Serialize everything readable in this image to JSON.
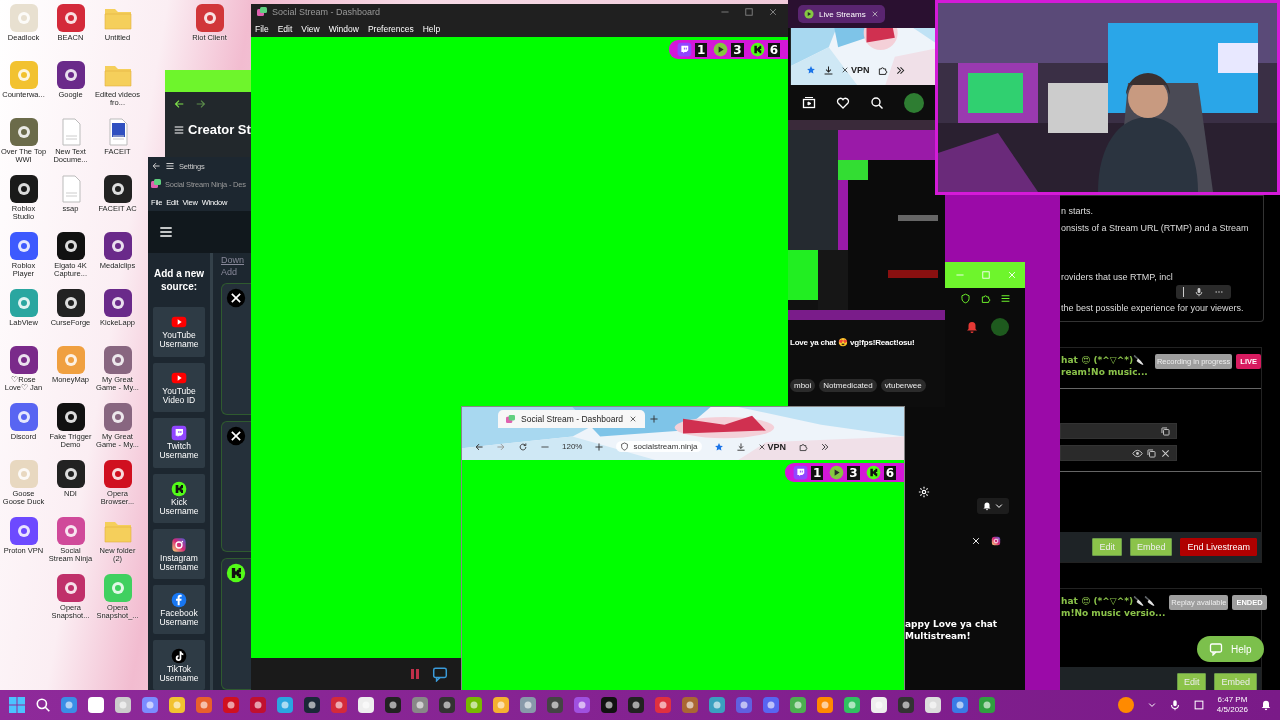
{
  "desktop": {
    "columns": [
      {
        "icons": [
          {
            "label": "Deadlock",
            "kind": "app",
            "color": "#e8e0d0"
          },
          {
            "label": "Counterwa...",
            "kind": "app",
            "color": "#f2c230"
          },
          {
            "label": "Over The Top WWI",
            "kind": "app",
            "color": "#6b6b4a"
          },
          {
            "label": "Roblox Studio",
            "kind": "app",
            "color": "#1a1a1a"
          },
          {
            "label": "Roblox Player",
            "kind": "app",
            "color": "#3d5afe"
          },
          {
            "label": "LabView",
            "kind": "app",
            "color": "#2aa6a0"
          },
          {
            "label": "♡Rose Love♡ Jan",
            "kind": "app",
            "color": "#7a2a8a"
          },
          {
            "label": "Discord",
            "kind": "app",
            "color": "#5865f2"
          },
          {
            "label": "Goose Goose Duck",
            "kind": "app",
            "color": "#e8d8c0"
          },
          {
            "label": "Proton VPN",
            "kind": "app",
            "color": "#6d4aff"
          }
        ]
      },
      {
        "icons": [
          {
            "label": "BEACN",
            "kind": "app",
            "color": "#d42a3a"
          },
          {
            "label": "Google",
            "kind": "app",
            "color": "#6a2a8a"
          },
          {
            "label": "New Text Docume...",
            "kind": "document",
            "color": "#ffffff"
          },
          {
            "label": "ssap",
            "kind": "document",
            "color": "#ffffff"
          },
          {
            "label": "Elgato 4K Capture...",
            "kind": "app",
            "color": "#111111"
          },
          {
            "label": "CurseForge",
            "kind": "app",
            "color": "#222222"
          },
          {
            "label": "MoneyMap",
            "kind": "app",
            "color": "#f0a040"
          },
          {
            "label": "Fake Trigger Demo",
            "kind": "app",
            "color": "#111111"
          },
          {
            "label": "NDI",
            "kind": "app",
            "color": "#222222"
          },
          {
            "label": "Social Stream Ninja",
            "kind": "app",
            "color": "#d04a9a"
          },
          {
            "label": "Opera Snapshot...",
            "kind": "app",
            "color": "#c0306a"
          }
        ]
      },
      {
        "icons": [
          {
            "label": "Untitled",
            "kind": "folder",
            "color": "#f5cf5b"
          },
          {
            "label": "Edited videos fro...",
            "kind": "folder",
            "color": "#f5cf5b"
          },
          {
            "label": "FACEIT",
            "kind": "document",
            "color": "#3050c0"
          },
          {
            "label": "FACEIT AC",
            "kind": "app",
            "color": "#222222"
          },
          {
            "label": "Medalclips",
            "kind": "app",
            "color": "#6a2a8a"
          },
          {
            "label": "KickeLapp",
            "kind": "app",
            "color": "#6a2a8a"
          },
          {
            "label": "My Great Game - My...",
            "kind": "app",
            "color": "#886680"
          },
          {
            "label": "My Great Game - My...",
            "kind": "app",
            "color": "#886680"
          },
          {
            "label": "Opera Browser...",
            "kind": "app",
            "color": "#d01020"
          },
          {
            "label": "New folder (2)",
            "kind": "folder",
            "color": "#f5cf5b"
          },
          {
            "label": "Opera Snapshot_...",
            "kind": "app",
            "color": "#40d060"
          }
        ]
      }
    ],
    "corner_icon": {
      "label": "Riot Client",
      "kind": "app",
      "color": "#d13639"
    }
  },
  "creator_window": {
    "title": "Creator St"
  },
  "ssn_window": {
    "nav_label": "Settings",
    "title": "Social Stream Ninja - Des",
    "menu": [
      "File",
      "Edit",
      "View",
      "Window"
    ],
    "link": "Down",
    "hint": "Add",
    "heading": "Add a new source:",
    "sources": [
      {
        "label": "YouTube Username",
        "kind": "youtube"
      },
      {
        "label": "YouTube Video ID",
        "kind": "youtube"
      },
      {
        "label": "Twitch Username",
        "kind": "twitch"
      },
      {
        "label": "Kick Username",
        "kind": "kick"
      },
      {
        "label": "Instagram Username",
        "kind": "instagram"
      },
      {
        "label": "Facebook Username",
        "kind": "facebook"
      },
      {
        "label": "TikTok Username",
        "kind": "tiktok"
      }
    ],
    "cards": [
      {
        "kind": "x"
      },
      {
        "kind": "x"
      },
      {
        "kind": "kick"
      }
    ]
  },
  "dashboard_window": {
    "title": "Social Stream - Dashboard",
    "menu": [
      "File",
      "Edit",
      "View",
      "Window",
      "Preferences",
      "Help"
    ],
    "counts": [
      {
        "kind": "twitch",
        "value": "1"
      },
      {
        "kind": "rumble",
        "value": "3"
      },
      {
        "kind": "kick",
        "value": "6"
      }
    ]
  },
  "stream_page": {
    "tabs": [
      {
        "label": "Live Streams",
        "selected": true
      }
    ],
    "vpn": "VPN",
    "stream_title": "Love ya chat 😍 vg!fps!React!osu!",
    "tags": [
      "mboi",
      "Notmedicated",
      "vtuberwee"
    ]
  },
  "side_window": {
    "lines": [
      "appy Love ya chat",
      "Multistream!"
    ]
  },
  "studio_panel": {
    "intro": [
      "n starts.",
      "onsists of a Stream URL (RTMP) and a Stream",
      "roviders that use RTMP, incl",
      "the best possible experience for your viewers."
    ],
    "streams": [
      {
        "title": "hat 😍 (*^▽^*)🔪",
        "subtitle": "ream!No music...",
        "status": "Recording in progress",
        "badge": "LIVE",
        "live": true,
        "buttons": [
          {
            "label": "Edit",
            "kind": "light"
          },
          {
            "label": "Embed",
            "kind": "light"
          },
          {
            "label": "End Livestream",
            "kind": "danger"
          }
        ]
      },
      {
        "title": "hat 😍 (*^▽^*)🔪🔪",
        "subtitle": "m!No music versio...",
        "status": "Replay available",
        "badge": "ENDED",
        "live": false,
        "buttons": [
          {
            "label": "Edit",
            "kind": "light"
          },
          {
            "label": "Embed",
            "kind": "light"
          }
        ]
      }
    ],
    "help": "Help"
  },
  "mini_browser": {
    "tab": "Social Stream - Dashboard",
    "zoom": "120%",
    "url": "socialstream.ninja",
    "vpn": "VPN",
    "counts": [
      {
        "kind": "twitch",
        "value": "1"
      },
      {
        "kind": "rumble",
        "value": "3"
      },
      {
        "kind": "kick",
        "value": "6"
      }
    ]
  },
  "taskbar": {
    "apps": [
      {
        "color": "#3a8ee6"
      },
      {
        "color": "#ffffff"
      },
      {
        "color": "#cccccc"
      },
      {
        "color": "#7b8cff"
      },
      {
        "color": "#f2c230"
      },
      {
        "color": "#e8602c"
      },
      {
        "color": "#d01020"
      },
      {
        "color": "#c01030"
      },
      {
        "color": "#2aa6e0"
      },
      {
        "color": "#1b2838"
      },
      {
        "color": "#d42a3a"
      },
      {
        "color": "#eeeeee"
      },
      {
        "color": "#222222"
      },
      {
        "color": "#888888"
      },
      {
        "color": "#333333"
      },
      {
        "color": "#76b900"
      },
      {
        "color": "#f5b030"
      },
      {
        "color": "#8899aa"
      },
      {
        "color": "#444444"
      },
      {
        "color": "#a050e0"
      },
      {
        "color": "#111111"
      },
      {
        "color": "#222222"
      },
      {
        "color": "#e03040"
      },
      {
        "color": "#aa6633"
      },
      {
        "color": "#3aa0c0"
      },
      {
        "color": "#6060e0"
      },
      {
        "color": "#5865f2"
      },
      {
        "color": "#4caf50"
      },
      {
        "color": "#ff8800"
      },
      {
        "color": "#30c060"
      },
      {
        "color": "#eeeeee"
      },
      {
        "color": "#333333"
      },
      {
        "color": "#dddddd"
      },
      {
        "color": "#3a7ae6"
      },
      {
        "color": "#30a040"
      }
    ],
    "time": "6:47 PM",
    "date": "4/5/2026"
  }
}
